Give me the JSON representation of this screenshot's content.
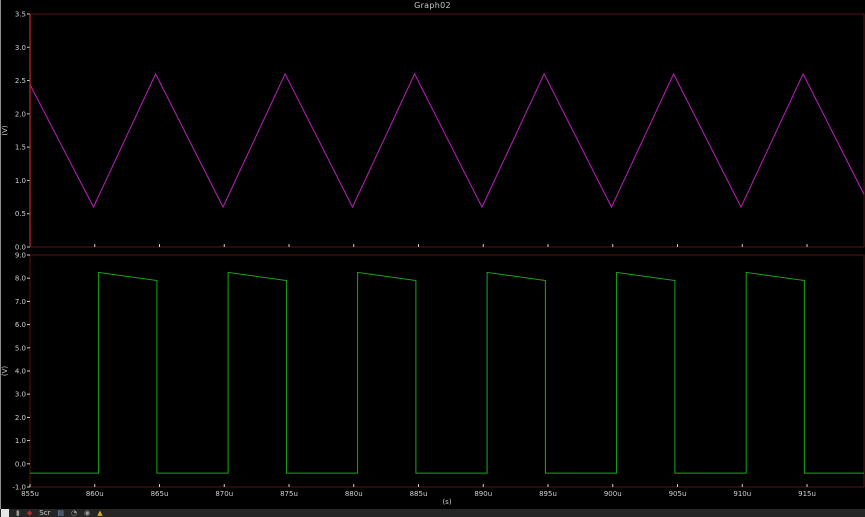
{
  "window": {
    "title": "Graph02"
  },
  "colors": {
    "background": "#000000",
    "panel_border": "#571414",
    "top_axis_line": "#cc2626",
    "axis_text": "#cfcfcf",
    "triangle_trace": "#bb1fbb",
    "square_trace": "#18a818",
    "taskbar_bg": "#252525",
    "warning_yellow": "#e0a818"
  },
  "chart_data": {
    "type": "line",
    "title": "Graph02",
    "xlabel": "(s)",
    "x_unit_suffix": "u",
    "xlim": [
      855,
      919.4
    ],
    "xticks": [
      855,
      860,
      865,
      870,
      875,
      880,
      885,
      890,
      895,
      900,
      905,
      910,
      915
    ],
    "grid": false,
    "legend": "none",
    "panels": [
      {
        "name": "triangle-panel",
        "ylabel": "(V)",
        "ylim": [
          0,
          3.5
        ],
        "yticks": [
          0.0,
          0.5,
          1.0,
          1.5,
          2.0,
          2.5,
          3.0,
          3.5
        ],
        "series": [
          {
            "name": "triangle-wave",
            "color": "#bb1fbb",
            "shape": "triangle",
            "period_us": 10,
            "min_v": 0.6,
            "max_v": 2.6,
            "points": [
              [
                855.0,
                2.44
              ],
              [
                859.9,
                0.6
              ],
              [
                864.7,
                2.6
              ],
              [
                869.9,
                0.6
              ],
              [
                874.7,
                2.6
              ],
              [
                879.9,
                0.6
              ],
              [
                884.7,
                2.6
              ],
              [
                889.9,
                0.6
              ],
              [
                894.7,
                2.6
              ],
              [
                899.9,
                0.6
              ],
              [
                904.7,
                2.6
              ],
              [
                909.9,
                0.6
              ],
              [
                914.7,
                2.6
              ],
              [
                919.4,
                0.79
              ]
            ]
          }
        ]
      },
      {
        "name": "square-panel",
        "ylabel": "(V)",
        "ylim": [
          -1,
          9
        ],
        "yticks": [
          -1.0,
          0.0,
          1.0,
          2.0,
          3.0,
          4.0,
          5.0,
          6.0,
          7.0,
          8.0,
          9.0
        ],
        "series": [
          {
            "name": "square-wave",
            "color": "#18a818",
            "shape": "square",
            "period_us": 10,
            "low_v": -0.4,
            "high_start_v": 8.25,
            "high_end_v": 7.9,
            "points": [
              [
                855.0,
                -0.4
              ],
              [
                860.3,
                -0.4
              ],
              [
                860.3,
                8.25
              ],
              [
                864.8,
                7.9
              ],
              [
                864.8,
                -0.4
              ],
              [
                870.3,
                -0.4
              ],
              [
                870.3,
                8.25
              ],
              [
                874.8,
                7.9
              ],
              [
                874.8,
                -0.4
              ],
              [
                880.3,
                -0.4
              ],
              [
                880.3,
                8.25
              ],
              [
                884.8,
                7.9
              ],
              [
                884.8,
                -0.4
              ],
              [
                890.3,
                -0.4
              ],
              [
                890.3,
                8.25
              ],
              [
                894.8,
                7.9
              ],
              [
                894.8,
                -0.4
              ],
              [
                900.3,
                -0.4
              ],
              [
                900.3,
                8.25
              ],
              [
                904.8,
                7.9
              ],
              [
                904.8,
                -0.4
              ],
              [
                910.3,
                -0.4
              ],
              [
                910.3,
                8.25
              ],
              [
                914.8,
                7.9
              ],
              [
                914.8,
                -0.4
              ],
              [
                919.4,
                -0.4
              ]
            ]
          }
        ]
      }
    ]
  },
  "taskbar": {
    "items": [
      {
        "name": "app-window-icon",
        "glyph": "▮",
        "color": "#9a9a9a"
      },
      {
        "name": "logo-icon",
        "glyph": "◆",
        "color": "#b03030"
      },
      {
        "name": "scr-label",
        "label": "Scr",
        "color": "#c8c8c8"
      },
      {
        "name": "save-icon",
        "glyph": "▤",
        "color": "#7f9fc0"
      },
      {
        "name": "clock-icon",
        "glyph": "◔",
        "color": "#9a9a9a"
      },
      {
        "name": "info-icon",
        "glyph": "◉",
        "color": "#9a9a9a"
      },
      {
        "name": "warning-icon",
        "glyph": "▲",
        "color": "#e0a818"
      }
    ]
  }
}
